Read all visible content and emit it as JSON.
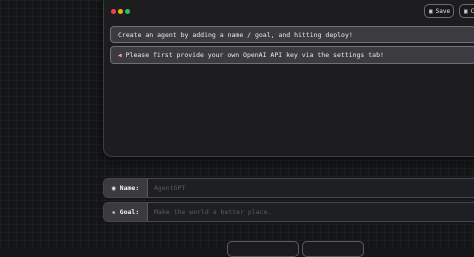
{
  "window": {
    "controls": [
      "close-dot",
      "minimize-dot",
      "maximize-dot"
    ],
    "save_label": "Save",
    "copy_label": "Co",
    "save_icon": "save-icon",
    "copy_icon": "copy-icon"
  },
  "messages": [
    {
      "text": "Create an agent by adding a name / goal, and hitting deploy!"
    },
    {
      "icon": "warning-icon",
      "text": "Please first provide your own OpenAI API key via the settings tab!"
    }
  ],
  "form": {
    "name": {
      "label": "Name:",
      "placeholder": "AgentGPT",
      "value": "",
      "icon": "robot-icon"
    },
    "goal": {
      "label": "Goal:",
      "placeholder": "Make the world a better place.",
      "value": "",
      "icon": "star-icon"
    }
  },
  "colors": {
    "background": "#141516",
    "window": "#1d1d20",
    "message_bg": "#3b3b40",
    "dot_red": "#ef4444",
    "dot_yellow": "#eab308",
    "dot_green": "#22c55e"
  }
}
